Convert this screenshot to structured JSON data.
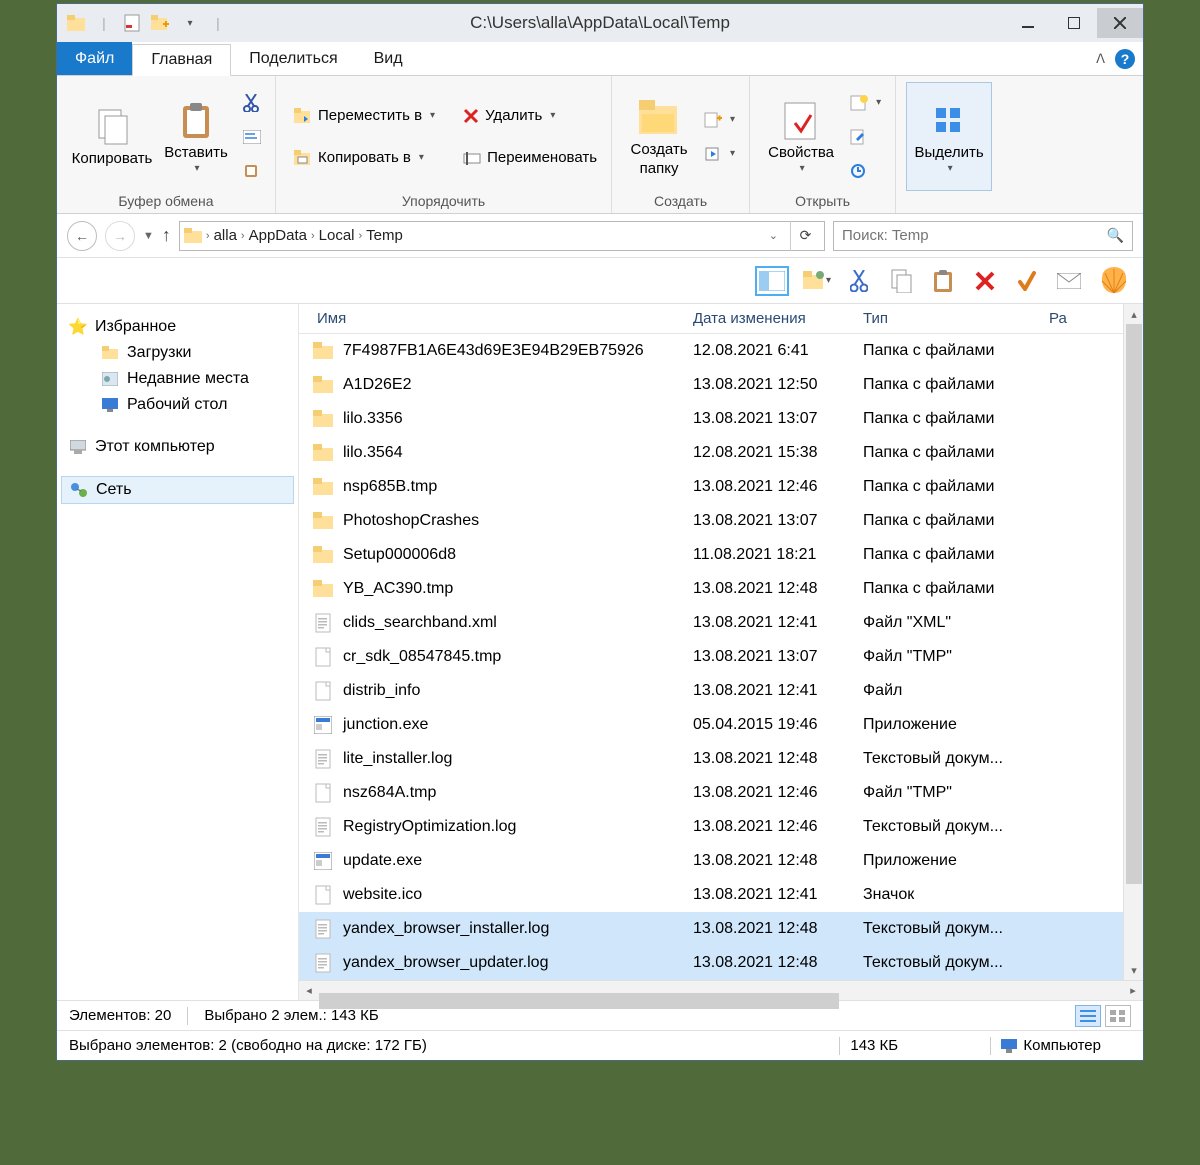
{
  "title": "C:\\Users\\alla\\AppData\\Local\\Temp",
  "tabs": {
    "file": "Файл",
    "main": "Главная",
    "share": "Поделиться",
    "view": "Вид"
  },
  "ribbon": {
    "clipboard": {
      "copy": "Копировать",
      "paste": "Вставить",
      "label": "Буфер обмена"
    },
    "organize": {
      "moveTo": "Переместить в",
      "copyTo": "Копировать в",
      "delete": "Удалить",
      "rename": "Переименовать",
      "label": "Упорядочить"
    },
    "new": {
      "newFolder_l1": "Создать",
      "newFolder_l2": "папку",
      "label": "Создать"
    },
    "open": {
      "properties": "Свойства",
      "label": "Открыть"
    },
    "select": {
      "select": "Выделить"
    }
  },
  "breadcrumb": [
    "alla",
    "AppData",
    "Local",
    "Temp"
  ],
  "search": {
    "placeholder": "Поиск: Temp"
  },
  "tree": {
    "favorites": "Избранное",
    "downloads": "Загрузки",
    "recent": "Недавние места",
    "desktop": "Рабочий стол",
    "computer": "Этот компьютер",
    "network": "Сеть"
  },
  "columns": {
    "name": "Имя",
    "date": "Дата изменения",
    "type": "Тип",
    "size": "Ра"
  },
  "files": [
    {
      "icon": "folder",
      "name": "7F4987FB1A6E43d69E3E94B29EB75926",
      "date": "12.08.2021 6:41",
      "type": "Папка с файлами",
      "sel": false
    },
    {
      "icon": "folder",
      "name": "A1D26E2",
      "date": "13.08.2021 12:50",
      "type": "Папка с файлами",
      "sel": false
    },
    {
      "icon": "folder",
      "name": "lilo.3356",
      "date": "13.08.2021 13:07",
      "type": "Папка с файлами",
      "sel": false
    },
    {
      "icon": "folder",
      "name": "lilo.3564",
      "date": "12.08.2021 15:38",
      "type": "Папка с файлами",
      "sel": false
    },
    {
      "icon": "folder",
      "name": "nsp685B.tmp",
      "date": "13.08.2021 12:46",
      "type": "Папка с файлами",
      "sel": false
    },
    {
      "icon": "folder",
      "name": "PhotoshopCrashes",
      "date": "13.08.2021 13:07",
      "type": "Папка с файлами",
      "sel": false
    },
    {
      "icon": "folder",
      "name": "Setup000006d8",
      "date": "11.08.2021 18:21",
      "type": "Папка с файлами",
      "sel": false
    },
    {
      "icon": "folder",
      "name": "YB_AC390.tmp",
      "date": "13.08.2021 12:48",
      "type": "Папка с файлами",
      "sel": false
    },
    {
      "icon": "text",
      "name": "clids_searchband.xml",
      "date": "13.08.2021 12:41",
      "type": "Файл \"XML\"",
      "sel": false
    },
    {
      "icon": "file",
      "name": "cr_sdk_08547845.tmp",
      "date": "13.08.2021 13:07",
      "type": "Файл \"TMP\"",
      "sel": false
    },
    {
      "icon": "file",
      "name": "distrib_info",
      "date": "13.08.2021 12:41",
      "type": "Файл",
      "sel": false
    },
    {
      "icon": "exe",
      "name": "junction.exe",
      "date": "05.04.2015 19:46",
      "type": "Приложение",
      "sel": false
    },
    {
      "icon": "text",
      "name": "lite_installer.log",
      "date": "13.08.2021 12:48",
      "type": "Текстовый докум...",
      "sel": false
    },
    {
      "icon": "file",
      "name": "nsz684A.tmp",
      "date": "13.08.2021 12:46",
      "type": "Файл \"TMP\"",
      "sel": false
    },
    {
      "icon": "text",
      "name": "RegistryOptimization.log",
      "date": "13.08.2021 12:46",
      "type": "Текстовый докум...",
      "sel": false
    },
    {
      "icon": "exe",
      "name": "update.exe",
      "date": "13.08.2021 12:48",
      "type": "Приложение",
      "sel": false
    },
    {
      "icon": "file",
      "name": "website.ico",
      "date": "13.08.2021 12:41",
      "type": "Значок",
      "sel": false
    },
    {
      "icon": "text",
      "name": "yandex_browser_installer.log",
      "date": "13.08.2021 12:48",
      "type": "Текстовый докум...",
      "sel": true
    },
    {
      "icon": "text",
      "name": "yandex_browser_updater.log",
      "date": "13.08.2021 12:48",
      "type": "Текстовый докум...",
      "sel": true
    }
  ],
  "status1": {
    "items": "Элементов: 20",
    "selected": "Выбрано 2 элем.: 143 КБ"
  },
  "status2": {
    "selection": "Выбрано элементов: 2 (свободно на диске: 172 ГБ)",
    "size": "143 КБ",
    "computer": "Компьютер"
  }
}
